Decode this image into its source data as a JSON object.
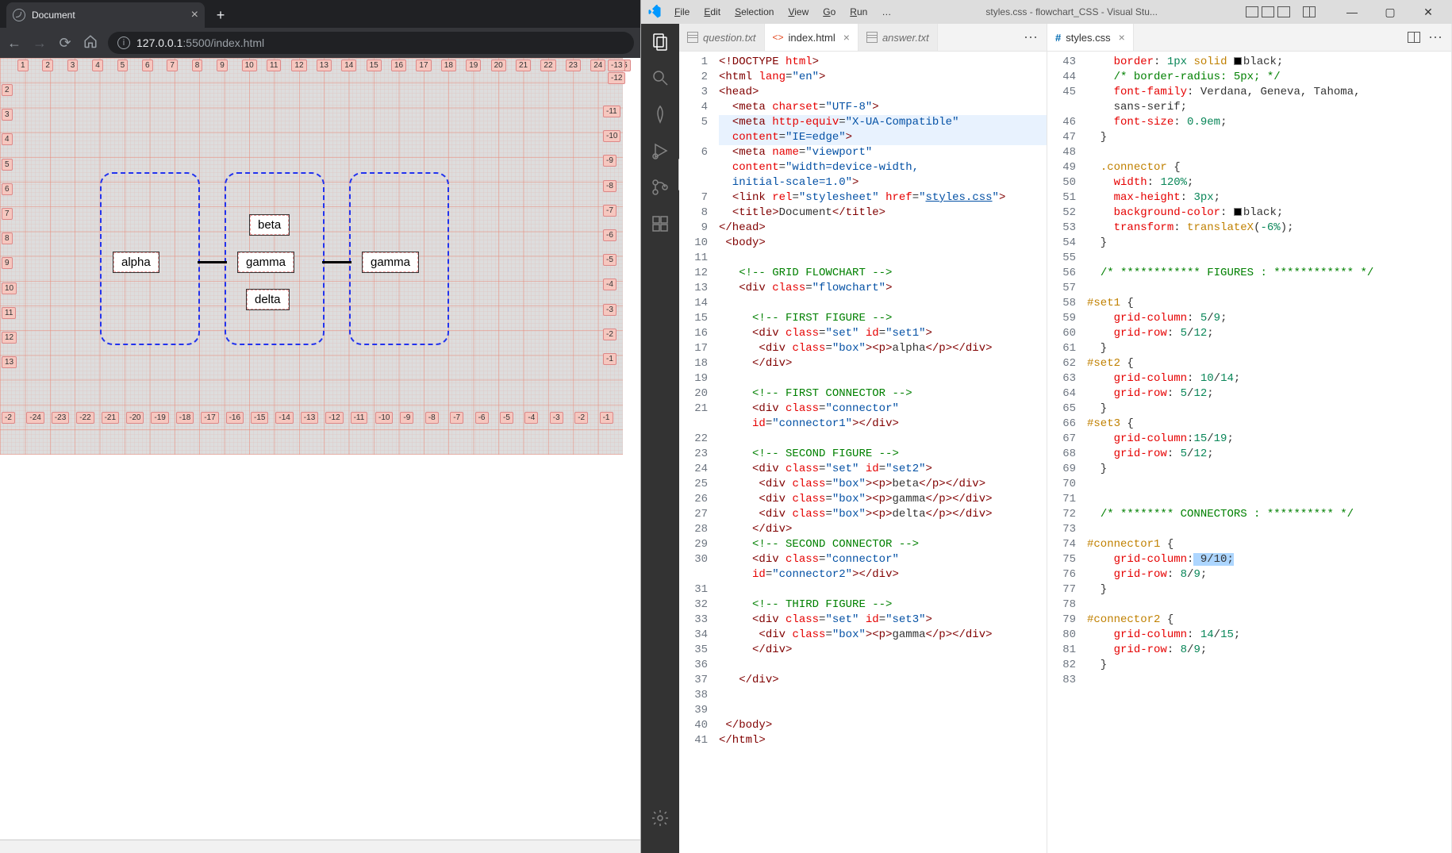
{
  "browser": {
    "tab_title": "Document",
    "newtab_glyph": "+",
    "tab_close": "×",
    "url_prefix": "127.0.0.1",
    "url_rest": ":5500/index.html",
    "nav": {
      "back": "←",
      "forward": "→",
      "reload": "⟳",
      "home": "⌂"
    },
    "grid_top_nums": [
      "1",
      "2",
      "3",
      "4",
      "5",
      "6",
      "7",
      "8",
      "9",
      "10",
      "11",
      "12",
      "13",
      "14",
      "15",
      "16",
      "17",
      "18",
      "19",
      "20",
      "21",
      "22",
      "23",
      "24",
      "25"
    ],
    "grid_top_right": [
      "-13",
      "-12"
    ],
    "grid_left_nums": [
      "2",
      "3",
      "4",
      "5",
      "6",
      "7",
      "8",
      "9",
      "10",
      "11",
      "12",
      "13"
    ],
    "grid_right_nums": [
      "-11",
      "-10",
      "-9",
      "-8",
      "-7",
      "-6",
      "-5",
      "-4",
      "-3",
      "-2",
      "-1"
    ],
    "grid_bottom_nums": [
      "-2",
      "-24",
      "-23",
      "-22",
      "-21",
      "-20",
      "-19",
      "-18",
      "-17",
      "-16",
      "-15",
      "-14",
      "-13",
      "-12",
      "-11",
      "-10",
      "-9",
      "-8",
      "-7",
      "-6",
      "-5",
      "-4",
      "-3",
      "-2",
      "-1"
    ],
    "boxes": {
      "alpha": "alpha",
      "beta": "beta",
      "gamma": "gamma",
      "delta": "delta",
      "gamma2": "gamma"
    }
  },
  "vscode": {
    "title": "styles.css - flowchart_CSS - Visual Stu...",
    "menus": [
      "File",
      "Edit",
      "Selection",
      "View",
      "Go",
      "Run",
      "…"
    ],
    "tabs_left": [
      {
        "name": "question.txt",
        "type": "txt",
        "active": false
      },
      {
        "name": "index.html",
        "type": "html",
        "active": true,
        "close": true
      },
      {
        "name": "answer.txt",
        "type": "txt",
        "active": false
      }
    ],
    "tabs_right": [
      {
        "name": "styles.css",
        "type": "css",
        "active": true,
        "close": true
      }
    ],
    "html_lines": [
      {
        "n": 1,
        "html": "<span class='brown'>&lt;!DOCTYPE <span class='red'>html</span>&gt;</span>"
      },
      {
        "n": 2,
        "html": "<span class='brown'>&lt;html</span> <span class='red'>lang</span>=<span class='darkblue'>\"en\"</span><span class='brown'>&gt;</span>"
      },
      {
        "n": 3,
        "html": "<span class='brown'>&lt;head&gt;</span>"
      },
      {
        "n": 4,
        "html": "  <span class='brown'>&lt;meta</span> <span class='red'>charset</span>=<span class='darkblue'>\"UTF-8\"</span><span class='brown'>&gt;</span>"
      },
      {
        "n": 5,
        "html": "  <span class='brown'>&lt;meta</span> <span class='red'>http-equiv</span>=<span class='darkblue'>\"X-UA-Compatible\"</span><br>  <span class='red'>content</span>=<span class='darkblue'>\"IE=edge\"</span><span class='brown'>&gt;</span>",
        "hl": true
      },
      {
        "n": 6,
        "html": "  <span class='brown'>&lt;meta</span> <span class='red'>name</span>=<span class='darkblue'>\"viewport\"</span><br>  <span class='red'>content</span>=<span class='darkblue'>\"width=device-width,<br>  initial-scale=1.0\"</span><span class='brown'>&gt;</span>"
      },
      {
        "n": 7,
        "html": "  <span class='brown'>&lt;link</span> <span class='red'>rel</span>=<span class='darkblue'>\"stylesheet\"</span> <span class='red'>href</span>=<span class='darkblue'>\"<u>styles.css</u>\"</span><span class='brown'>&gt;</span>"
      },
      {
        "n": 8,
        "html": "  <span class='brown'>&lt;title&gt;</span>Document<span class='brown'>&lt;/title&gt;</span>"
      },
      {
        "n": 9,
        "html": "<span class='brown'>&lt;/head&gt;</span>"
      },
      {
        "n": 10,
        "html": " <span class='brown'>&lt;body&gt;</span>"
      },
      {
        "n": 11,
        "html": ""
      },
      {
        "n": 12,
        "html": "   <span class='green'>&lt;!-- GRID FLOWCHART --&gt;</span>"
      },
      {
        "n": 13,
        "html": "   <span class='brown'>&lt;div</span> <span class='red'>class</span>=<span class='darkblue'>\"flowchart\"</span><span class='brown'>&gt;</span>"
      },
      {
        "n": 14,
        "html": ""
      },
      {
        "n": 15,
        "html": "     <span class='green'>&lt;!-- FIRST FIGURE --&gt;</span>"
      },
      {
        "n": 16,
        "html": "     <span class='brown'>&lt;div</span> <span class='red'>class</span>=<span class='darkblue'>\"set\"</span> <span class='red'>id</span>=<span class='darkblue'>\"set1\"</span><span class='brown'>&gt;</span>"
      },
      {
        "n": 17,
        "html": "      <span class='brown'>&lt;div</span> <span class='red'>class</span>=<span class='darkblue'>\"box\"</span><span class='brown'>&gt;&lt;p&gt;</span>alpha<span class='brown'>&lt;/p&gt;&lt;/div&gt;</span>"
      },
      {
        "n": 18,
        "html": "     <span class='brown'>&lt;/div&gt;</span>"
      },
      {
        "n": 19,
        "html": ""
      },
      {
        "n": 20,
        "html": "     <span class='green'>&lt;!-- FIRST CONNECTOR --&gt;</span>"
      },
      {
        "n": 21,
        "html": "     <span class='brown'>&lt;div</span> <span class='red'>class</span>=<span class='darkblue'>\"connector\"</span><br>     <span class='red'>id</span>=<span class='darkblue'>\"connector1\"</span><span class='brown'>&gt;&lt;/div&gt;</span>"
      },
      {
        "n": 22,
        "html": ""
      },
      {
        "n": 23,
        "html": "     <span class='green'>&lt;!-- SECOND FIGURE --&gt;</span>"
      },
      {
        "n": 24,
        "html": "     <span class='brown'>&lt;div</span> <span class='red'>class</span>=<span class='darkblue'>\"set\"</span> <span class='red'>id</span>=<span class='darkblue'>\"set2\"</span><span class='brown'>&gt;</span>"
      },
      {
        "n": 25,
        "html": "      <span class='brown'>&lt;div</span> <span class='red'>class</span>=<span class='darkblue'>\"box\"</span><span class='brown'>&gt;&lt;p&gt;</span>beta<span class='brown'>&lt;/p&gt;&lt;/div&gt;</span>"
      },
      {
        "n": 26,
        "html": "      <span class='brown'>&lt;div</span> <span class='red'>class</span>=<span class='darkblue'>\"box\"</span><span class='brown'>&gt;&lt;p&gt;</span>gamma<span class='brown'>&lt;/p&gt;&lt;/div&gt;</span>"
      },
      {
        "n": 27,
        "html": "      <span class='brown'>&lt;div</span> <span class='red'>class</span>=<span class='darkblue'>\"box\"</span><span class='brown'>&gt;&lt;p&gt;</span>delta<span class='brown'>&lt;/p&gt;&lt;/div&gt;</span>"
      },
      {
        "n": 28,
        "html": "     <span class='brown'>&lt;/div&gt;</span>"
      },
      {
        "n": 29,
        "html": "     <span class='green'>&lt;!-- SECOND CONNECTOR --&gt;</span>"
      },
      {
        "n": 30,
        "html": "     <span class='brown'>&lt;div</span> <span class='red'>class</span>=<span class='darkblue'>\"connector\"</span><br>     <span class='red'>id</span>=<span class='darkblue'>\"connector2\"</span><span class='brown'>&gt;&lt;/div&gt;</span>"
      },
      {
        "n": 31,
        "html": ""
      },
      {
        "n": 32,
        "html": "     <span class='green'>&lt;!-- THIRD FIGURE --&gt;</span>"
      },
      {
        "n": 33,
        "html": "     <span class='brown'>&lt;div</span> <span class='red'>class</span>=<span class='darkblue'>\"set\"</span> <span class='red'>id</span>=<span class='darkblue'>\"set3\"</span><span class='brown'>&gt;</span>"
      },
      {
        "n": 34,
        "html": "      <span class='brown'>&lt;div</span> <span class='red'>class</span>=<span class='darkblue'>\"box\"</span><span class='brown'>&gt;&lt;p&gt;</span>gamma<span class='brown'>&lt;/p&gt;&lt;/div&gt;</span>"
      },
      {
        "n": 35,
        "html": "     <span class='brown'>&lt;/div&gt;</span>"
      },
      {
        "n": 36,
        "html": ""
      },
      {
        "n": 37,
        "html": "   <span class='brown'>&lt;/div&gt;</span>"
      },
      {
        "n": 38,
        "html": ""
      },
      {
        "n": 39,
        "html": ""
      },
      {
        "n": 40,
        "html": " <span class='brown'>&lt;/body&gt;</span>"
      },
      {
        "n": 41,
        "html": "<span class='brown'>&lt;/html&gt;</span>"
      }
    ],
    "css_lines": [
      {
        "n": 43,
        "html": "    <span class='red'>border</span>: <span class='num'>1px</span> <span class='orange'>solid</span> <span class='swatch black'></span>black;"
      },
      {
        "n": 44,
        "html": "    <span class='green'>/* border-radius: 5px; */</span>"
      },
      {
        "n": 45,
        "html": "    <span class='red'>font-family</span>: Verdana, Geneva, Tahoma,<br>    sans-serif;"
      },
      {
        "n": 46,
        "html": "    <span class='red'>font-size</span>: <span class='num'>0.9em</span>;"
      },
      {
        "n": 47,
        "html": "  }"
      },
      {
        "n": 48,
        "html": ""
      },
      {
        "n": 49,
        "html": "  <span class='orange'>.connector</span> {"
      },
      {
        "n": 50,
        "html": "    <span class='red'>width</span>: <span class='num'>120%</span>;"
      },
      {
        "n": 51,
        "html": "    <span class='red'>max-height</span>: <span class='num'>3px</span>;"
      },
      {
        "n": 52,
        "html": "    <span class='red'>background-color</span>: <span class='swatch black'></span>black;"
      },
      {
        "n": 53,
        "html": "    <span class='red'>transform</span>: <span class='orange'>translateX</span>(<span class='num'>-6%</span>);"
      },
      {
        "n": 54,
        "html": "  }"
      },
      {
        "n": 55,
        "html": ""
      },
      {
        "n": 56,
        "html": "  <span class='green'>/* ************ FIGURES : ************ */</span>"
      },
      {
        "n": 57,
        "html": ""
      },
      {
        "n": 58,
        "html": "<span class='orange'>#set1</span> {"
      },
      {
        "n": 59,
        "html": "    <span class='red'>grid-column</span>: <span class='num'>5</span>/<span class='num'>9</span>;"
      },
      {
        "n": 60,
        "html": "    <span class='red'>grid-row</span>: <span class='num'>5</span>/<span class='num'>12</span>;"
      },
      {
        "n": 61,
        "html": "  }"
      },
      {
        "n": 62,
        "html": "<span class='orange'>#set2</span> {"
      },
      {
        "n": 63,
        "html": "    <span class='red'>grid-column</span>: <span class='num'>10</span>/<span class='num'>14</span>;"
      },
      {
        "n": 64,
        "html": "    <span class='red'>grid-row</span>: <span class='num'>5</span>/<span class='num'>12</span>;"
      },
      {
        "n": 65,
        "html": "  }"
      },
      {
        "n": 66,
        "html": "<span class='orange'>#set3</span> {"
      },
      {
        "n": 67,
        "html": "    <span class='red'>grid-column</span>:<span class='num'>15</span>/<span class='num'>19</span>;"
      },
      {
        "n": 68,
        "html": "    <span class='red'>grid-row</span>: <span class='num'>5</span>/<span class='num'>12</span>;"
      },
      {
        "n": 69,
        "html": "  }"
      },
      {
        "n": 70,
        "html": ""
      },
      {
        "n": 71,
        "html": ""
      },
      {
        "n": 72,
        "html": "  <span class='green'>/* ******** CONNECTORS : ********** */</span>"
      },
      {
        "n": 73,
        "html": ""
      },
      {
        "n": 74,
        "html": "<span class='orange'>#connector1</span> {"
      },
      {
        "n": 75,
        "html": "    <span class='red'>grid-column</span>:<span class='sel'> 9/10;</span>"
      },
      {
        "n": 76,
        "html": "    <span class='red'>grid-row</span>: <span class='num'>8</span>/<span class='num'>9</span>;"
      },
      {
        "n": 77,
        "html": "  }"
      },
      {
        "n": 78,
        "html": ""
      },
      {
        "n": 79,
        "html": "<span class='orange'>#connector2</span> {"
      },
      {
        "n": 80,
        "html": "    <span class='red'>grid-column</span>: <span class='num'>14</span>/<span class='num'>15</span>;"
      },
      {
        "n": 81,
        "html": "    <span class='red'>grid-row</span>: <span class='num'>8</span>/<span class='num'>9</span>;"
      },
      {
        "n": 82,
        "html": "  }"
      },
      {
        "n": 83,
        "html": ""
      }
    ]
  }
}
